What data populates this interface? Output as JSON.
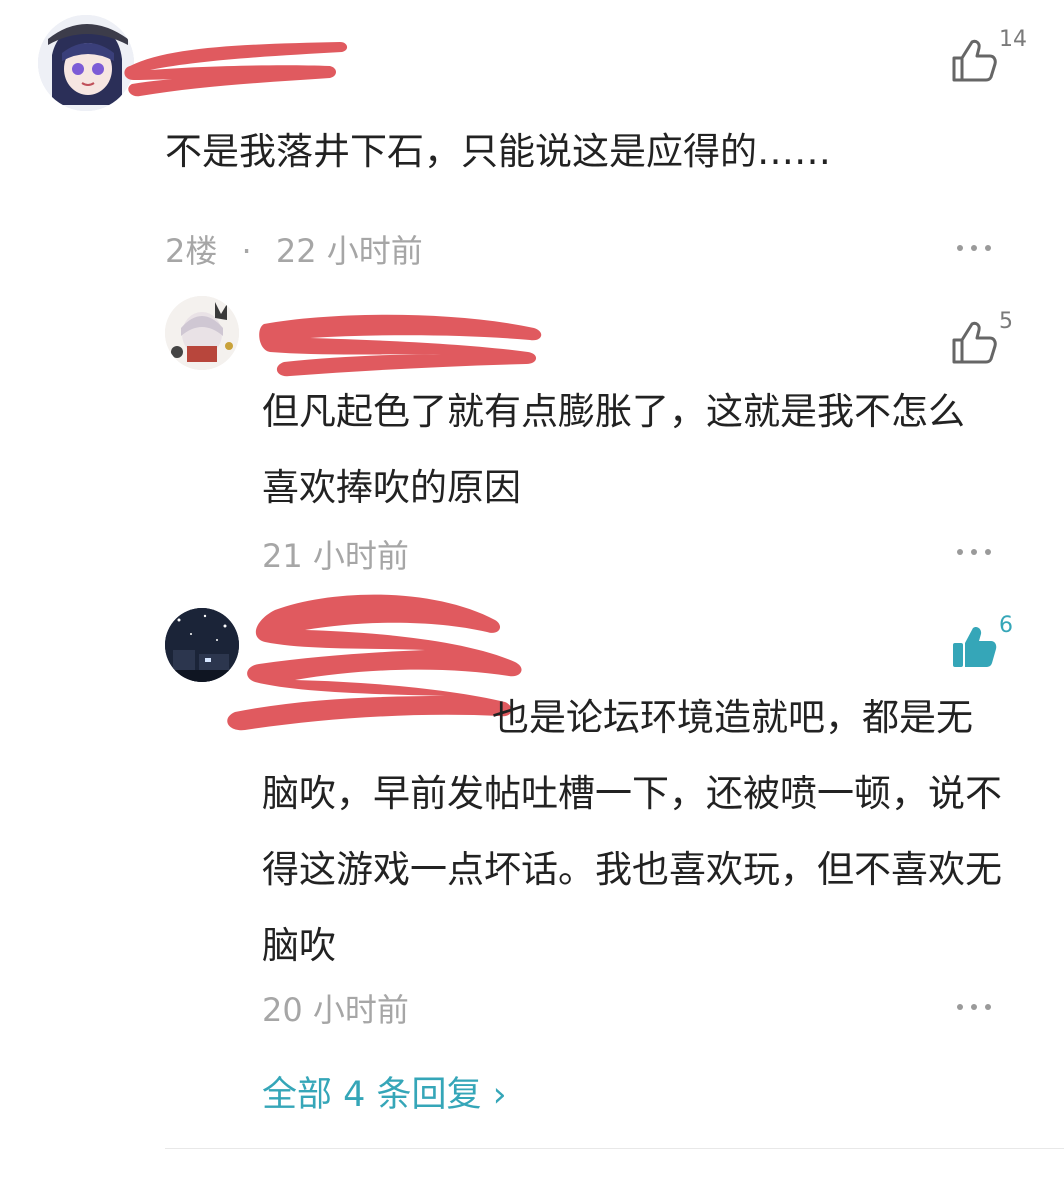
{
  "comments": [
    {
      "content": "不是我落井下石，只能说这是应得的……",
      "floor": "2楼",
      "separator": "·",
      "time": "22 小时前",
      "likes": "14",
      "liked": false
    },
    {
      "content": "但凡起色了就有点膨胀了，这就是我不怎么喜欢捧吹的原因",
      "time": "21 小时前",
      "likes": "5",
      "liked": false
    },
    {
      "content": "也是论坛环境造就吧，都是无脑吹，早前发帖吐槽一下，还被喷一顿，说不得这游戏一点坏话。我也喜欢玩，但不喜欢无脑吹",
      "time": "20 小时前",
      "likes": "6",
      "liked": true
    }
  ],
  "view_all_replies": "全部 4 条回复 ›",
  "colors": {
    "accent": "#35a6b8",
    "redaction": "#e05a5f",
    "meta": "#a6a6a6"
  },
  "icons": [
    "thumbs-up-outline-icon",
    "thumbs-up-filled-icon",
    "more-dots-icon",
    "chevron-right-icon"
  ]
}
